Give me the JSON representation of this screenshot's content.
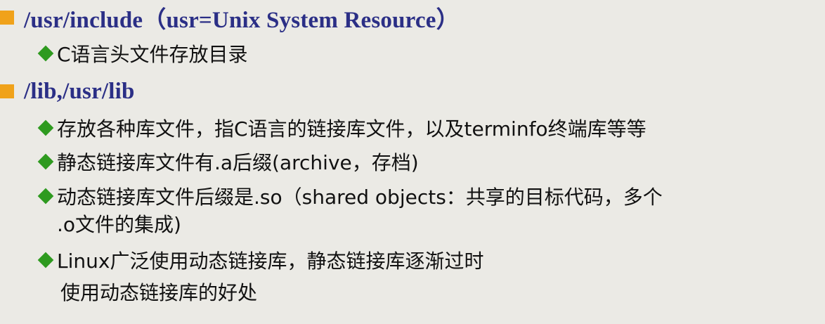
{
  "heading1": "/usr/include（usr=Unix System Resource）",
  "bullet_c_headers": "C语言头文件存放目录",
  "heading2": "/lib,/usr/lib",
  "bullet_libs": "存放各种库文件，指C语言的链接库文件，以及terminfo终端库等等",
  "bullet_static": "静态链接库文件有.a后缀(archive，存档)",
  "bullet_dynamic_line1": "动态链接库文件后缀是.so（shared objects：共享的目标代码，多个",
  "bullet_dynamic_line2": ".o文件的集成)",
  "bullet_linux": "Linux广泛使用动态链接库，静态链接库逐渐过时",
  "note_advantages": "使用动态链接库的好处",
  "colors": {
    "background": "#ebeae5",
    "heading_text": "#2b2f86",
    "square_bullet": "#f0a21a",
    "diamond_bullet": "#2e9a1f",
    "body_text": "#111111"
  }
}
